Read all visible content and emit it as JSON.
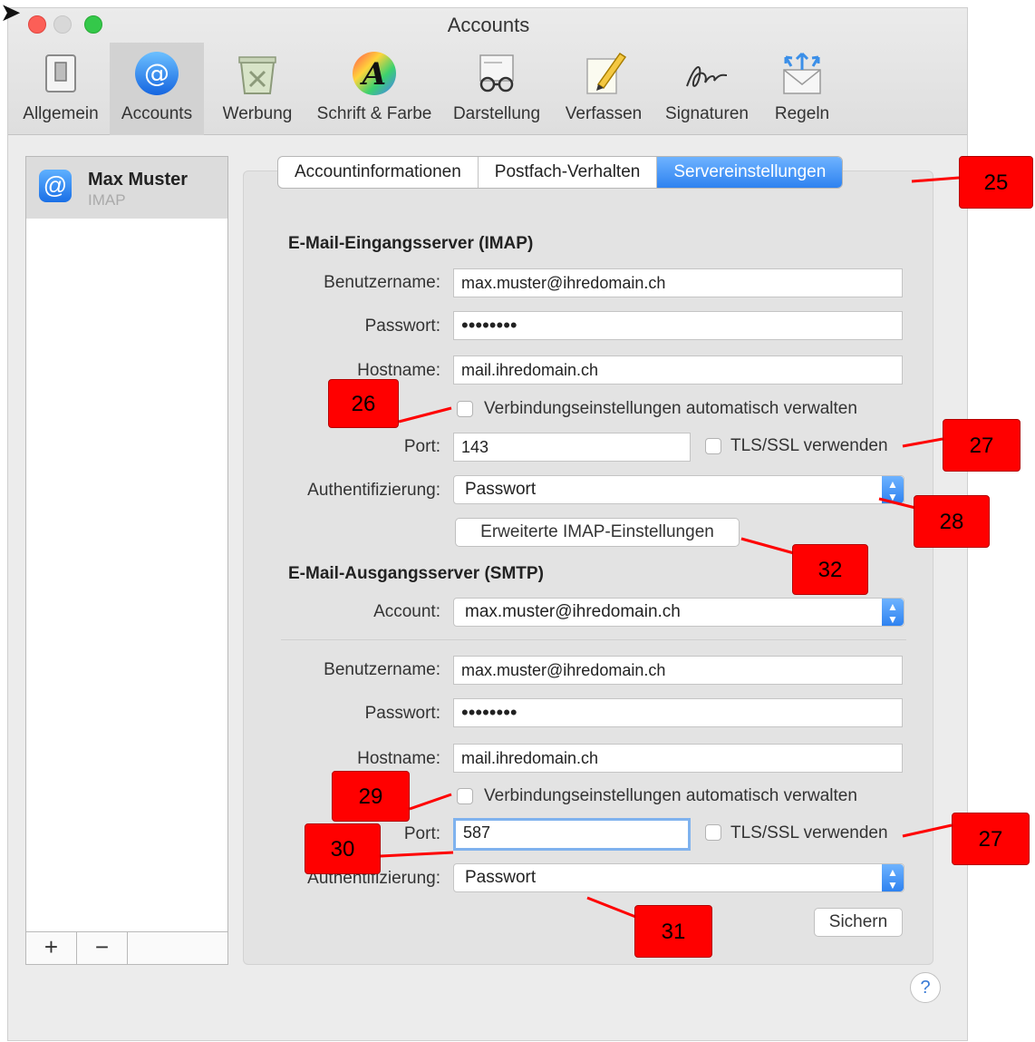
{
  "window": {
    "title": "Accounts"
  },
  "toolbar": {
    "items": [
      {
        "label": "Allgemein",
        "icon": "switch-icon"
      },
      {
        "label": "Accounts",
        "icon": "at-icon"
      },
      {
        "label": "Werbung",
        "icon": "junk-icon"
      },
      {
        "label": "Schrift & Farbe",
        "icon": "font-icon"
      },
      {
        "label": "Darstellung",
        "icon": "glasses-icon"
      },
      {
        "label": "Verfassen",
        "icon": "pencil-icon"
      },
      {
        "label": "Signaturen",
        "icon": "signature-icon"
      },
      {
        "label": "Regeln",
        "icon": "rules-icon"
      }
    ],
    "active_index": 1
  },
  "sidebar": {
    "account": {
      "name": "Max Muster",
      "type": "IMAP"
    },
    "add_label": "+",
    "remove_label": "−"
  },
  "tabs": [
    "Accountinformationen",
    "Postfach-Verhalten",
    "Servereinstellungen"
  ],
  "active_tab": "Servereinstellungen",
  "incoming": {
    "title": "E-Mail-Eingangsserver (IMAP)",
    "username_label": "Benutzername:",
    "username": "max.muster@ihredomain.ch",
    "password_label": "Passwort:",
    "password": "••••••••",
    "hostname_label": "Hostname:",
    "hostname": "mail.ihredomain.ch",
    "auto_manage_label": "Verbindungseinstellungen automatisch verwalten",
    "auto_manage_checked": false,
    "port_label": "Port:",
    "port": "143",
    "tls_label": "TLS/SSL verwenden",
    "tls_checked": false,
    "auth_label": "Authentifizierung:",
    "auth": "Passwort",
    "advanced_button": "Erweiterte IMAP-Einstellungen"
  },
  "outgoing": {
    "title": "E-Mail-Ausgangsserver (SMTP)",
    "account_label": "Account:",
    "account": "max.muster@ihredomain.ch",
    "username_label": "Benutzername:",
    "username": "max.muster@ihredomain.ch",
    "password_label": "Passwort:",
    "password": "••••••••",
    "hostname_label": "Hostname:",
    "hostname": "mail.ihredomain.ch",
    "auto_manage_label": "Verbindungseinstellungen automatisch verwalten",
    "auto_manage_checked": false,
    "port_label": "Port:",
    "port": "587",
    "tls_label": "TLS/SSL verwenden",
    "tls_checked": false,
    "auth_label": "Authentifizierung:",
    "auth": "Passwort"
  },
  "save_button": "Sichern",
  "help_label": "?",
  "annotations": [
    "25",
    "26",
    "27",
    "28",
    "32",
    "29",
    "30",
    "27",
    "31"
  ],
  "colors": {
    "accent": "#2e82f0",
    "annotation": "#ff0000"
  }
}
